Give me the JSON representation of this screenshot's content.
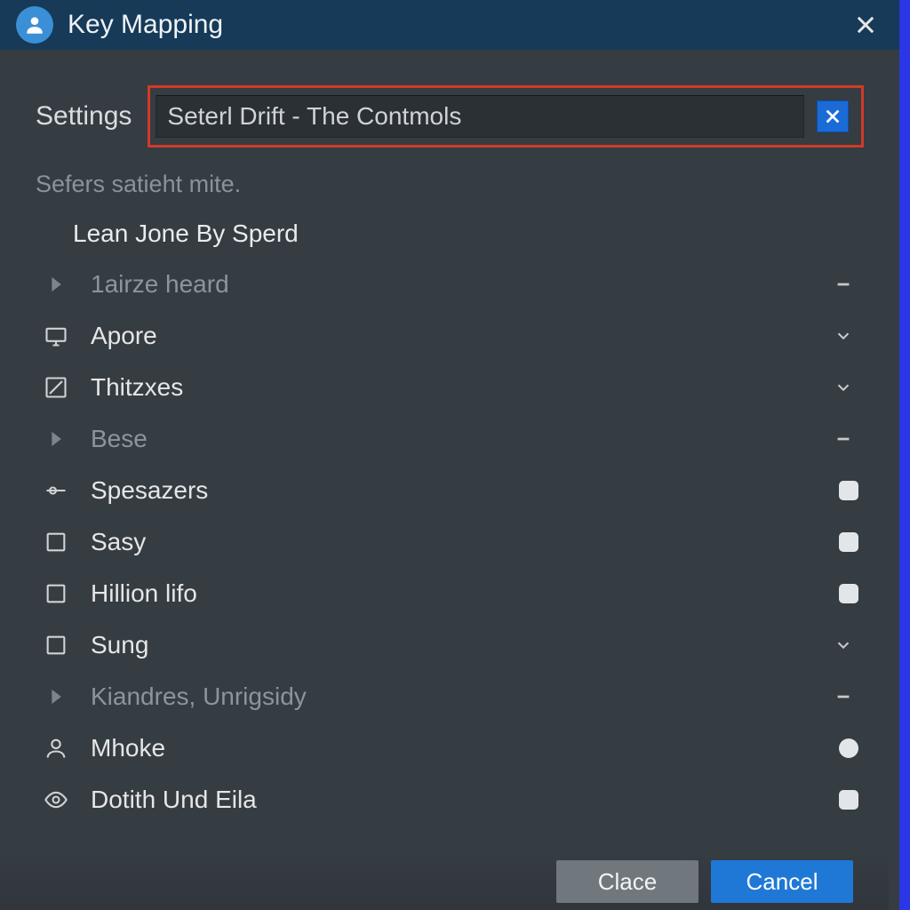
{
  "header": {
    "title": "Key Mapping"
  },
  "top": {
    "settings_label": "Settings",
    "search_value": "Seterl Drift - The Contmols",
    "subtext": "Sefers satieht mite.",
    "subheader": "Lean Jone By Sperd"
  },
  "groups": [
    {
      "label": "1airze heard",
      "collapsed": true,
      "items": [
        {
          "icon": "monitor",
          "label": "Apore",
          "tail": "chevron"
        },
        {
          "icon": "pencil-box",
          "label": "Thitzxes",
          "tail": "chevron"
        }
      ]
    },
    {
      "label": "Bese",
      "collapsed": true,
      "items": [
        {
          "icon": "slider",
          "label": "Spesazers",
          "tail": "box"
        },
        {
          "icon": "square",
          "label": "Sasy",
          "tail": "box"
        },
        {
          "icon": "square",
          "label": "Hillion lifo",
          "tail": "box"
        },
        {
          "icon": "square",
          "label": "Sung",
          "tail": "chevron"
        }
      ]
    },
    {
      "label": "Kiandres, Unrigsidy",
      "collapsed": true,
      "items": [
        {
          "icon": "person",
          "label": "Mhoke",
          "tail": "circle"
        },
        {
          "icon": "eye",
          "label": "Dotith Und Eila",
          "tail": "box"
        }
      ]
    }
  ],
  "footer": {
    "secondary": "Clace",
    "primary": "Cancel"
  }
}
